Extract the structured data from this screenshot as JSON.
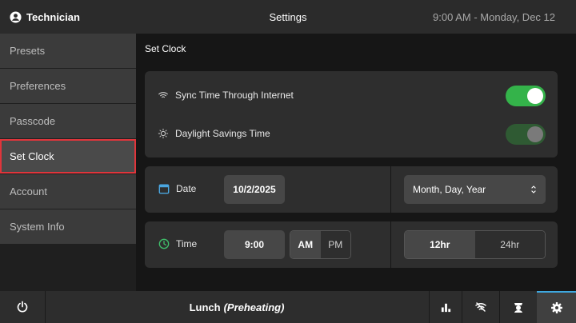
{
  "header": {
    "user": "Technician",
    "title": "Settings",
    "datetime": "9:00 AM - Monday, Dec 12"
  },
  "sidebar": {
    "items": [
      {
        "label": "Presets"
      },
      {
        "label": "Preferences"
      },
      {
        "label": "Passcode"
      },
      {
        "label": "Set Clock",
        "active": true
      },
      {
        "label": "Account"
      },
      {
        "label": "System Info"
      }
    ]
  },
  "main": {
    "title": "Set Clock",
    "sync": {
      "label": "Sync Time Through Internet",
      "enabled": true
    },
    "dst": {
      "label": "Daylight Savings Time",
      "enabled": true,
      "disabled_look": true
    },
    "date": {
      "label": "Date",
      "value": "10/2/2025",
      "format": "Month, Day, Year"
    },
    "time": {
      "label": "Time",
      "value": "9:00",
      "am": "AM",
      "pm": "PM",
      "selected_period": "AM",
      "h12": "12hr",
      "h24": "24hr",
      "selected_format": "12hr"
    }
  },
  "footer": {
    "status_name": "Lunch",
    "status_state": "(Preheating)"
  },
  "colors": {
    "toggle_on": "#34b34a",
    "active_border": "#e0353b",
    "accent": "#3ea8e0"
  }
}
